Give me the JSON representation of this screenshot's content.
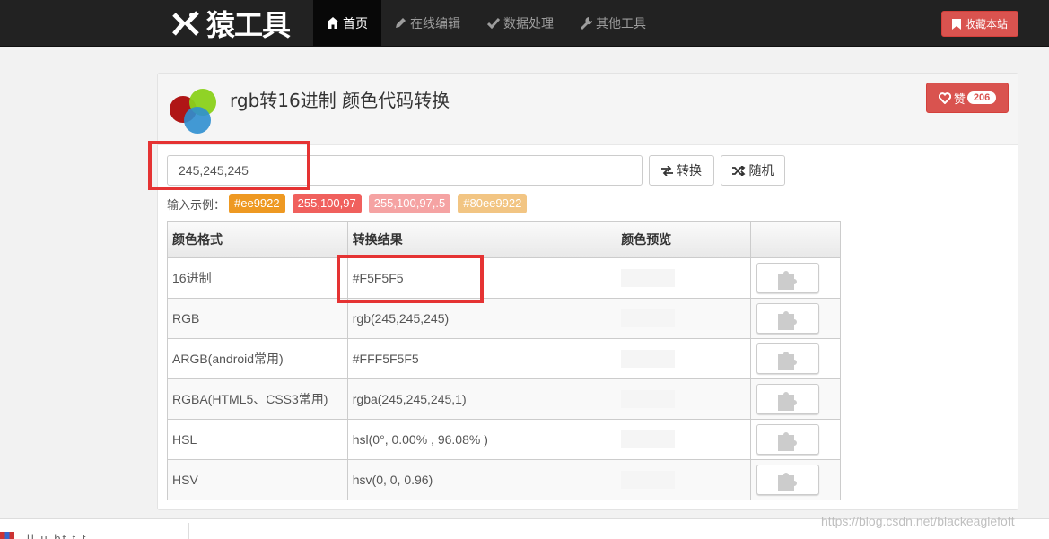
{
  "navbar": {
    "logo_text": "猿工具",
    "items": [
      {
        "label": "首页",
        "icon": "home-icon",
        "active": true
      },
      {
        "label": "在线编辑",
        "icon": "pencil-icon",
        "active": false
      },
      {
        "label": "数据处理",
        "icon": "check-icon",
        "active": false
      },
      {
        "label": "其他工具",
        "icon": "wrench-icon",
        "active": false
      }
    ],
    "favorite_label": "收藏本站"
  },
  "panel": {
    "title": "rgb转16进制 颜色代码转换",
    "like_label": "赞",
    "like_count": "206"
  },
  "converter": {
    "input_value": "245,245,245",
    "convert_label": "转换",
    "random_label": "随机",
    "examples_label": "输入示例：",
    "examples": [
      {
        "label": "#ee9922",
        "color": "#ee9922"
      },
      {
        "label": "255,100,97",
        "color": "#f0605d"
      },
      {
        "label": "255,100,97,.5",
        "color": "#f5a3a3"
      },
      {
        "label": "#80ee9922",
        "color": "#f2c583"
      }
    ]
  },
  "table": {
    "headers": [
      "颜色格式",
      "转换结果",
      "颜色预览",
      ""
    ],
    "rows": [
      {
        "format": "16进制",
        "result": "#F5F5F5"
      },
      {
        "format": "RGB",
        "result": "rgb(245,245,245)"
      },
      {
        "format": "ARGB(android常用)",
        "result": "#FFF5F5F5"
      },
      {
        "format": "RGBA(HTML5、CSS3常用)",
        "result": "rgba(245,245,245,1)"
      },
      {
        "format": "HSL",
        "result": "hsl(0°, 0.00% , 96.08% )"
      },
      {
        "format": "HSV",
        "result": "hsv(0, 0, 0.96)"
      }
    ],
    "preview_color": "#f5f5f5"
  },
  "bottom": {
    "text": "ll u bt t t",
    "watermark": "https://blog.csdn.net/blackeaglefoft"
  },
  "colors": {
    "navbar_bg": "#222222",
    "danger": "#d9534f",
    "highlight": "#e53333"
  }
}
